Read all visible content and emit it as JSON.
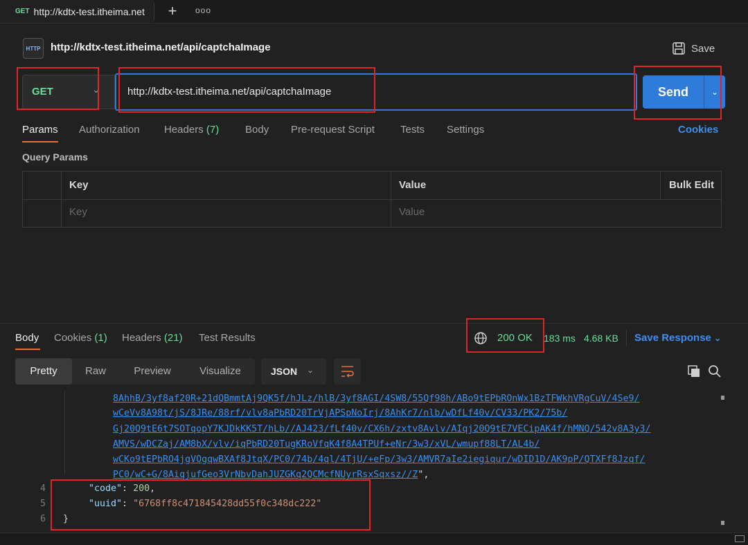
{
  "tab": {
    "method": "GET",
    "title": "http://kdtx-test.itheima.net"
  },
  "header": {
    "icon_label": "HTTP",
    "title": "http://kdtx-test.itheima.net/api/captchaImage",
    "save_label": "Save"
  },
  "request": {
    "method": "GET",
    "url": "http://kdtx-test.itheima.net/api/captchaImage",
    "send_label": "Send"
  },
  "request_tabs": [
    {
      "label": "Params"
    },
    {
      "label": "Authorization"
    },
    {
      "label": "Headers",
      "count": "(7)"
    },
    {
      "label": "Body"
    },
    {
      "label": "Pre-request Script"
    },
    {
      "label": "Tests"
    },
    {
      "label": "Settings"
    }
  ],
  "cookies_link": "Cookies",
  "query_params": {
    "title": "Query Params",
    "columns": [
      "Key",
      "Value",
      "Bulk Edit"
    ],
    "placeholder_key": "Key",
    "placeholder_value": "Value"
  },
  "response_tabs": [
    {
      "label": "Body"
    },
    {
      "label": "Cookies",
      "count": "(1)"
    },
    {
      "label": "Headers",
      "count": "(21)"
    },
    {
      "label": "Test Results"
    }
  ],
  "response_meta": {
    "status": "200 OK",
    "time": "183 ms",
    "size": "4.68 KB",
    "save_label": "Save Response"
  },
  "view_modes": [
    "Pretty",
    "Raw",
    "Preview",
    "Visualize"
  ],
  "format": "JSON",
  "code_lines": [
    {
      "num": "",
      "parts": [
        {
          "cls": "jlink",
          "t": "8AhhB/3yf8af20R+21dQBmmtAj9QK5f/hJLz/hlB/3yf8AGI/4SW8/55Qf98h/ABo9tEPbROnWx1BzTFWkhVRgCuV/4Se9/"
        }
      ]
    },
    {
      "num": "",
      "parts": [
        {
          "cls": "jlink",
          "t": "wCeVv8A98t/jS/8JRe/88rf/vlv8aPbRD20TrVjAPSpNoIrj/8AhKr7/nlb/wDfLf40v/CV33/PK2/75b/"
        }
      ]
    },
    {
      "num": "",
      "parts": [
        {
          "cls": "jlink",
          "t": "Gj20Q9tE6t7SOTqopY7KJDkKK5T/hLb//AJ423/fLf40v/CX6h/zxtv8Avlv/AIqj20Q9tE7VECipAK4f/hMNQ/542v8A3y3/"
        }
      ]
    },
    {
      "num": "",
      "parts": [
        {
          "cls": "jlink",
          "t": "AMVS/wDCZaj/AM8bX/vlv/iqPbRD20TugKRoVfqK4f8A4TPUf+eNr/3w3/xVL/wmupf88LT/AL4b/"
        }
      ]
    },
    {
      "num": "",
      "parts": [
        {
          "cls": "jlink",
          "t": "wCKo9tEPbRO4jgVOgqwBXAf8JtqX/PC0/74b/4ql/4TjU/+eFp/3w3/AMVR7aIe2iegiqur/wDID1D/AK9pP/QTXFf8Jzqf/"
        }
      ]
    },
    {
      "num": "",
      "parts": [
        {
          "cls": "jlink",
          "t": "PC0/wC+G/8AiqjufGeo3VrNbvDahJUZGKq2QCMcfNUyrRsxSqxsz//Z"
        },
        {
          "cls": "jpun",
          "t": "\","
        }
      ]
    },
    {
      "num": "4",
      "parts": [
        {
          "cls": "jkey",
          "t": "\"code\""
        },
        {
          "cls": "jpun",
          "t": ": "
        },
        {
          "cls": "jnum",
          "t": "200"
        },
        {
          "cls": "jpun",
          "t": ","
        }
      ]
    },
    {
      "num": "5",
      "parts": [
        {
          "cls": "jkey",
          "t": "\"uuid\""
        },
        {
          "cls": "jpun",
          "t": ": "
        },
        {
          "cls": "jstr",
          "t": "\"6768ff8c471845428dd55f0c348dc222\""
        }
      ]
    },
    {
      "num": "6",
      "parts": [
        {
          "cls": "jpun",
          "t": "}"
        }
      ]
    }
  ],
  "colors": {
    "accent": "#2f7bd9",
    "get_method": "#6bdd9a",
    "active_tab": "#f26b3a",
    "highlight": "#e0242a",
    "link": "#3d8ff0"
  }
}
